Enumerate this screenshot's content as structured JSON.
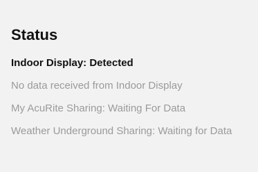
{
  "status_panel": {
    "title": "Status",
    "lines": [
      "Indoor Display: Detected",
      "No data received from Indoor Display",
      "My AcuRite Sharing: Waiting For Data",
      "Weather Underground Sharing: Waiting for Data"
    ]
  },
  "colors": {
    "background": "#f2f2f2",
    "primary_text": "#111111",
    "muted_text": "#9a9a9a"
  }
}
